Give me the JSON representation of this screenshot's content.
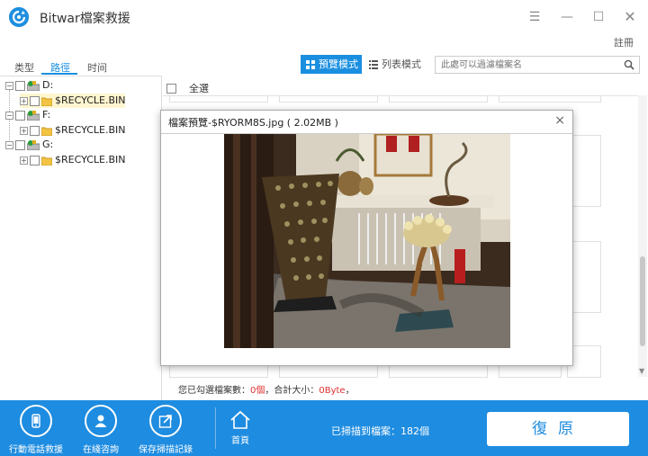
{
  "app": {
    "title": "Bitwar檔案救援",
    "register": "註冊"
  },
  "tabs": [
    {
      "label": "类型"
    },
    {
      "label": "路徑"
    },
    {
      "label": "时间"
    }
  ],
  "view_modes": {
    "preview": "預覽模式",
    "list": "列表模式"
  },
  "search": {
    "placeholder": "此處可以過濾檔案名"
  },
  "tree": [
    {
      "drive": "D:",
      "child": "$RECYCLE.BIN"
    },
    {
      "drive": "F:",
      "child": "$RECYCLE.BIN"
    },
    {
      "drive": "G:",
      "child": "$RECYCLE.BIN"
    }
  ],
  "main": {
    "select_all": "全選"
  },
  "dialog": {
    "title": "檔案預覽-$RYORM8S.jpg ( 2.02MB )",
    "close": "×"
  },
  "status": {
    "prefix": "您已勾選檔案數：",
    "count": "0個",
    "middle": "，合計大小：",
    "size": "0Byte",
    "suffix": "，"
  },
  "bottom": {
    "tools": [
      {
        "label": "行動電話救援",
        "icon": "phone-icon"
      },
      {
        "label": "在綫咨詢",
        "icon": "user-icon"
      },
      {
        "label": "保存掃描記錄",
        "icon": "export-icon"
      }
    ],
    "home": "首頁",
    "scan_count": "已掃描到檔案：182個",
    "restore": "復原"
  },
  "colors": {
    "accent": "#1e8ce0",
    "status_red": "#e03030"
  }
}
